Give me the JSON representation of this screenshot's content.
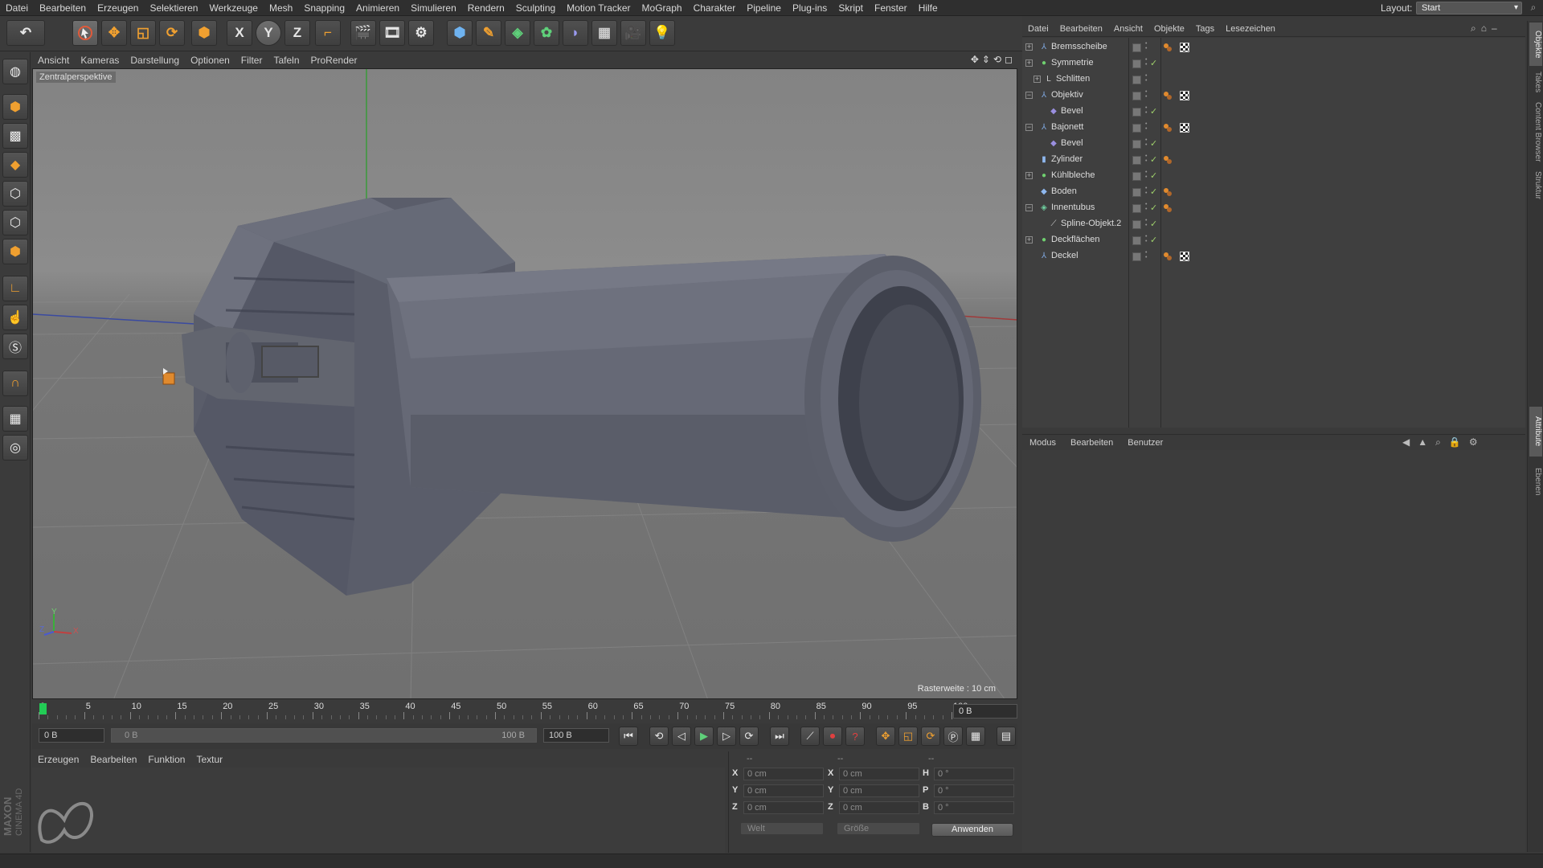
{
  "menubar": {
    "items": [
      "Datei",
      "Bearbeiten",
      "Erzeugen",
      "Selektieren",
      "Werkzeuge",
      "Mesh",
      "Snapping",
      "Animieren",
      "Simulieren",
      "Rendern",
      "Sculpting",
      "Motion Tracker",
      "MoGraph",
      "Charakter",
      "Pipeline",
      "Plug-ins",
      "Skript",
      "Fenster",
      "Hilfe"
    ],
    "layout_label": "Layout:",
    "layout_value": "Start"
  },
  "toolbar": {
    "axis_x": "X",
    "axis_y": "Y",
    "axis_z": "Z",
    "icons": [
      "undo-icon",
      "select-arrow-icon",
      "move-icon",
      "scale-icon",
      "rotate-icon",
      "object-icon",
      "axis-x-icon",
      "axis-y-icon",
      "axis-z-icon",
      "coordinate-system-icon",
      "render-view-icon",
      "render-picture-queue-icon",
      "render-settings-icon",
      "cube-icon",
      "pen-icon",
      "subdivision-icon",
      "cloner-icon",
      "deformer-icon",
      "floor-icon",
      "camera-icon",
      "light-icon"
    ]
  },
  "viewport": {
    "menu": [
      "Ansicht",
      "Kameras",
      "Darstellung",
      "Optionen",
      "Filter",
      "Tafeln",
      "ProRender"
    ],
    "camera_label": "Zentralperspektive",
    "grid_label": "Rasterweite : 10 cm",
    "axis_y": "Y",
    "axis_x": "X",
    "axis_z": "Z"
  },
  "timeline": {
    "ticks": [
      "0",
      "5",
      "10",
      "15",
      "20",
      "25",
      "30",
      "35",
      "40",
      "45",
      "50",
      "55",
      "60",
      "65",
      "70",
      "75",
      "80",
      "85",
      "90",
      "95",
      "100"
    ],
    "current_frame": "0 B",
    "start_field": "0 B",
    "range_start": "0 B",
    "range_end": "100 B",
    "end_field": "100 B"
  },
  "materials": {
    "menu": [
      "Erzeugen",
      "Bearbeiten",
      "Funktion",
      "Textur"
    ],
    "brand_line1": "MAXON",
    "brand_line2": "CINEMA 4D"
  },
  "coordinates": {
    "header": [
      "--",
      "--",
      "--"
    ],
    "rows": [
      {
        "l1": "X",
        "v1": "0 cm",
        "l2": "X",
        "v2": "0 cm",
        "l3": "H",
        "v3": "0 °"
      },
      {
        "l1": "Y",
        "v1": "0 cm",
        "l2": "Y",
        "v2": "0 cm",
        "l3": "P",
        "v3": "0 °"
      },
      {
        "l1": "Z",
        "v1": "0 cm",
        "l2": "Z",
        "v2": "0 cm",
        "l3": "B",
        "v3": "0 °"
      }
    ],
    "dropdown1": "Welt",
    "dropdown2": "Größe",
    "apply": "Anwenden"
  },
  "objects": {
    "menu": [
      "Datei",
      "Bearbeiten",
      "Ansicht",
      "Objekte",
      "Tags",
      "Lesezeichen"
    ],
    "items": [
      {
        "name": "Bremsscheibe",
        "icon": "null-icon",
        "color": "#7fa8e0",
        "indent": 0,
        "expander": "+",
        "check": false,
        "tagA": true,
        "tagB": true
      },
      {
        "name": "Symmetrie",
        "icon": "symmetry-icon",
        "color": "#6fd06f",
        "indent": 0,
        "expander": "+",
        "check": true,
        "tagA": false,
        "tagB": false
      },
      {
        "name": "Schlitten",
        "icon": "lo-icon",
        "color": "#cfcfcf",
        "indent": 1,
        "expander": "+",
        "check": false,
        "tagA": false,
        "tagB": false
      },
      {
        "name": "Objektiv",
        "icon": "null-icon",
        "color": "#7fa8e0",
        "indent": 0,
        "expander": "-",
        "check": false,
        "tagA": true,
        "tagB": true
      },
      {
        "name": "Bevel",
        "icon": "bevel-icon",
        "color": "#9a8fe0",
        "indent": 2,
        "expander": "",
        "check": true,
        "tagA": false,
        "tagB": false
      },
      {
        "name": "Bajonett",
        "icon": "null-icon",
        "color": "#7fa8e0",
        "indent": 0,
        "expander": "-",
        "check": false,
        "tagA": true,
        "tagB": true
      },
      {
        "name": "Bevel",
        "icon": "bevel-icon",
        "color": "#9a8fe0",
        "indent": 2,
        "expander": "",
        "check": true,
        "tagA": false,
        "tagB": false
      },
      {
        "name": "Zylinder",
        "icon": "cylinder-icon",
        "color": "#8fb8ef",
        "indent": 0,
        "expander": "",
        "check": true,
        "tagA": true,
        "tagB": false
      },
      {
        "name": "Kühlbleche",
        "icon": "symmetry-icon",
        "color": "#6fd06f",
        "indent": 0,
        "expander": "+",
        "check": true,
        "tagA": false,
        "tagB": false
      },
      {
        "name": "Boden",
        "icon": "polygon-icon",
        "color": "#8fb8ef",
        "indent": 0,
        "expander": "",
        "check": true,
        "tagA": true,
        "tagB": false
      },
      {
        "name": "Innentubus",
        "icon": "lathe-icon",
        "color": "#6fd0a0",
        "indent": 0,
        "expander": "-",
        "check": true,
        "tagA": true,
        "tagB": false
      },
      {
        "name": "Spline-Objekt.2",
        "icon": "spline-icon",
        "color": "#cfcfcf",
        "indent": 2,
        "expander": "",
        "check": true,
        "tagA": false,
        "tagB": false
      },
      {
        "name": "Deckflächen",
        "icon": "symmetry-icon",
        "color": "#6fd06f",
        "indent": 0,
        "expander": "+",
        "check": true,
        "tagA": false,
        "tagB": false
      },
      {
        "name": "Deckel",
        "icon": "null-icon",
        "color": "#7fa8e0",
        "indent": 0,
        "expander": "",
        "check": false,
        "tagA": true,
        "tagB": true
      }
    ]
  },
  "attributes": {
    "menu": [
      "Modus",
      "Bearbeiten",
      "Benutzer"
    ]
  },
  "sidetabs": [
    "Objekte",
    "Takes",
    "Content Browser",
    "Struktur",
    "Attribute",
    "Ebenen"
  ],
  "colors": {
    "background": "#3a3a3a",
    "viewport": "#7c7c7c",
    "model": "#5c5f6c",
    "accent_check": "#9ecf6b",
    "tag_orange": "#e08a2e",
    "playhead": "#22cc55"
  }
}
